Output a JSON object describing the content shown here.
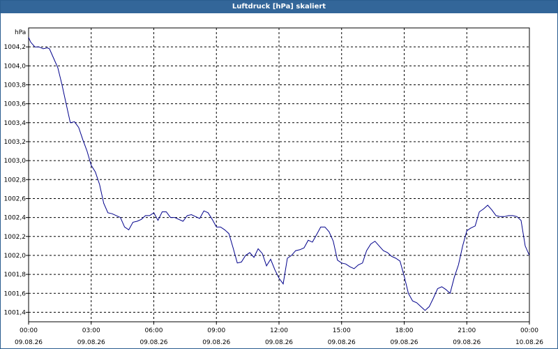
{
  "window": {
    "title": "Luftdruck [hPa] skaliert"
  },
  "chart_data": {
    "type": "line",
    "title": "Luftdruck [hPa] skaliert",
    "ylabel": "hPa",
    "ylim": [
      1001.3,
      1004.4
    ],
    "xlim_hours": [
      0,
      24
    ],
    "grid": true,
    "y_ticks": [
      "1001,4",
      "1001,6",
      "1001,8",
      "1002,0",
      "1002,2",
      "1002,4",
      "1002,6",
      "1002,8",
      "1003,0",
      "1003,2",
      "1003,4",
      "1003,6",
      "1003,8",
      "1004,0",
      "1004,2"
    ],
    "x_ticks": [
      {
        "time": "00:00",
        "date": "09.08.26"
      },
      {
        "time": "03:00",
        "date": "09.08.26"
      },
      {
        "time": "06:00",
        "date": "09.08.26"
      },
      {
        "time": "09:00",
        "date": "09.08.26"
      },
      {
        "time": "12:00",
        "date": "09.08.26"
      },
      {
        "time": "15:00",
        "date": "09.08.26"
      },
      {
        "time": "18:00",
        "date": "09.08.26"
      },
      {
        "time": "21:00",
        "date": "09.08.26"
      },
      {
        "time": "00:00",
        "date": "10.08.26"
      }
    ],
    "series": [
      {
        "color": "#00008b",
        "x_hours": [
          0.0,
          0.1,
          0.3,
          0.5,
          0.7,
          0.9,
          1.0,
          1.2,
          1.4,
          1.6,
          1.8,
          2.0,
          2.2,
          2.4,
          2.6,
          2.8,
          3.0,
          3.2,
          3.4,
          3.6,
          3.8,
          4.0,
          4.2,
          4.4,
          4.6,
          4.8,
          5.0,
          5.2,
          5.4,
          5.6,
          5.8,
          6.0,
          6.2,
          6.4,
          6.6,
          6.8,
          7.0,
          7.2,
          7.4,
          7.6,
          7.8,
          8.0,
          8.2,
          8.4,
          8.6,
          8.8,
          9.0,
          9.2,
          9.4,
          9.6,
          9.8,
          10.0,
          10.2,
          10.4,
          10.6,
          10.8,
          11.0,
          11.2,
          11.4,
          11.6,
          11.8,
          12.0,
          12.2,
          12.4,
          12.6,
          12.8,
          13.0,
          13.2,
          13.4,
          13.6,
          13.8,
          14.0,
          14.2,
          14.4,
          14.6,
          14.8,
          15.0,
          15.2,
          15.4,
          15.6,
          15.8,
          16.0,
          16.2,
          16.4,
          16.6,
          16.8,
          17.0,
          17.2,
          17.4,
          17.6,
          17.8,
          18.0,
          18.2,
          18.4,
          18.6,
          18.8,
          19.0,
          19.2,
          19.4,
          19.6,
          19.8,
          20.0,
          20.2,
          20.4,
          20.6,
          20.8,
          21.0,
          21.2,
          21.4,
          21.6,
          21.8,
          22.0,
          22.2,
          22.4,
          22.6,
          22.8,
          23.0,
          23.2,
          23.4,
          23.6,
          23.8,
          24.0
        ],
        "values": [
          1004.3,
          1004.25,
          1004.2,
          1004.2,
          1004.18,
          1004.19,
          1004.18,
          1004.08,
          1003.98,
          1003.8,
          1003.6,
          1003.4,
          1003.41,
          1003.35,
          1003.22,
          1003.1,
          1002.95,
          1002.88,
          1002.75,
          1002.55,
          1002.45,
          1002.44,
          1002.42,
          1002.4,
          1002.3,
          1002.27,
          1002.35,
          1002.36,
          1002.38,
          1002.42,
          1002.42,
          1002.45,
          1002.37,
          1002.46,
          1002.46,
          1002.4,
          1002.4,
          1002.38,
          1002.36,
          1002.42,
          1002.43,
          1002.41,
          1002.39,
          1002.47,
          1002.45,
          1002.38,
          1002.3,
          1002.3,
          1002.27,
          1002.23,
          1002.08,
          1001.92,
          1001.93,
          1002.0,
          1002.03,
          1001.98,
          1002.07,
          1002.02,
          1001.89,
          1001.96,
          1001.85,
          1001.76,
          1001.7,
          1001.97,
          1002.0,
          1002.05,
          1002.06,
          1002.08,
          1002.16,
          1002.14,
          1002.22,
          1002.3,
          1002.3,
          1002.25,
          1002.15,
          1001.95,
          1001.92,
          1001.91,
          1001.88,
          1001.86,
          1001.9,
          1001.92,
          1002.05,
          1002.12,
          1002.15,
          1002.1,
          1002.05,
          1002.03,
          1001.99,
          1001.97,
          1001.94,
          1001.78,
          1001.6,
          1001.52,
          1001.5,
          1001.46,
          1001.42,
          1001.46,
          1001.55,
          1001.65,
          1001.67,
          1001.64,
          1001.6,
          1001.77,
          1001.9,
          1002.1,
          1002.26,
          1002.29,
          1002.31,
          1002.46,
          1002.49,
          1002.53,
          1002.48,
          1002.42,
          1002.41,
          1002.41,
          1002.42,
          1002.42,
          1002.41,
          1002.37,
          1002.1,
          1002.0
        ]
      }
    ]
  }
}
